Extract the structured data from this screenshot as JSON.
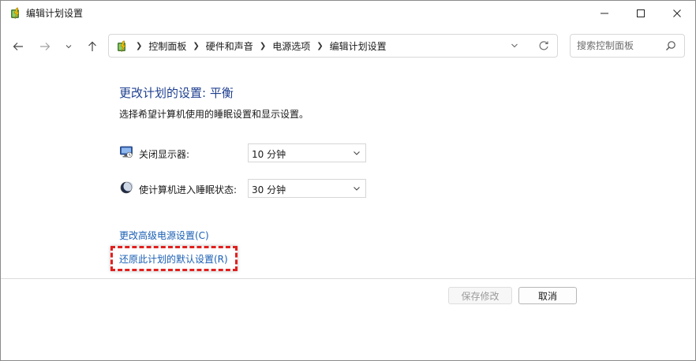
{
  "window": {
    "title": "编辑计划设置",
    "icons": {
      "app": "power-options-icon",
      "minimize": "minimize-icon",
      "maximize": "maximize-icon",
      "close": "close-icon"
    }
  },
  "nav": {
    "icons": {
      "back": "arrow-left-icon",
      "forward": "arrow-right-icon",
      "recent": "chevron-down-icon",
      "up": "arrow-up-icon"
    }
  },
  "address": {
    "crumbs": [
      "控制面板",
      "硬件和声音",
      "电源选项",
      "编辑计划设置"
    ],
    "icons": {
      "location": "power-options-icon",
      "separator": "chevron-right-icon",
      "dropdown": "chevron-down-icon",
      "refresh": "refresh-icon"
    }
  },
  "search": {
    "placeholder": "搜索控制面板",
    "icon": "search-icon"
  },
  "content": {
    "heading": "更改计划的设置: 平衡",
    "subtext": "选择希望计算机使用的睡眠设置和显示设置。",
    "display_off": {
      "label": "关闭显示器:",
      "value": "10 分钟",
      "icon": "monitor-icon"
    },
    "sleep": {
      "label": "使计算机进入睡眠状态:",
      "value": "30 分钟",
      "icon": "moon-icon"
    },
    "advanced_link": "更改高级电源设置(C)",
    "restore_link": "还原此计划的默认设置(R)",
    "highlight_color": "#e0201e",
    "link_color": "#1a5fb4",
    "heading_color": "#1e3f8f"
  },
  "footer": {
    "save_label": "保存修改",
    "cancel_label": "取消"
  }
}
